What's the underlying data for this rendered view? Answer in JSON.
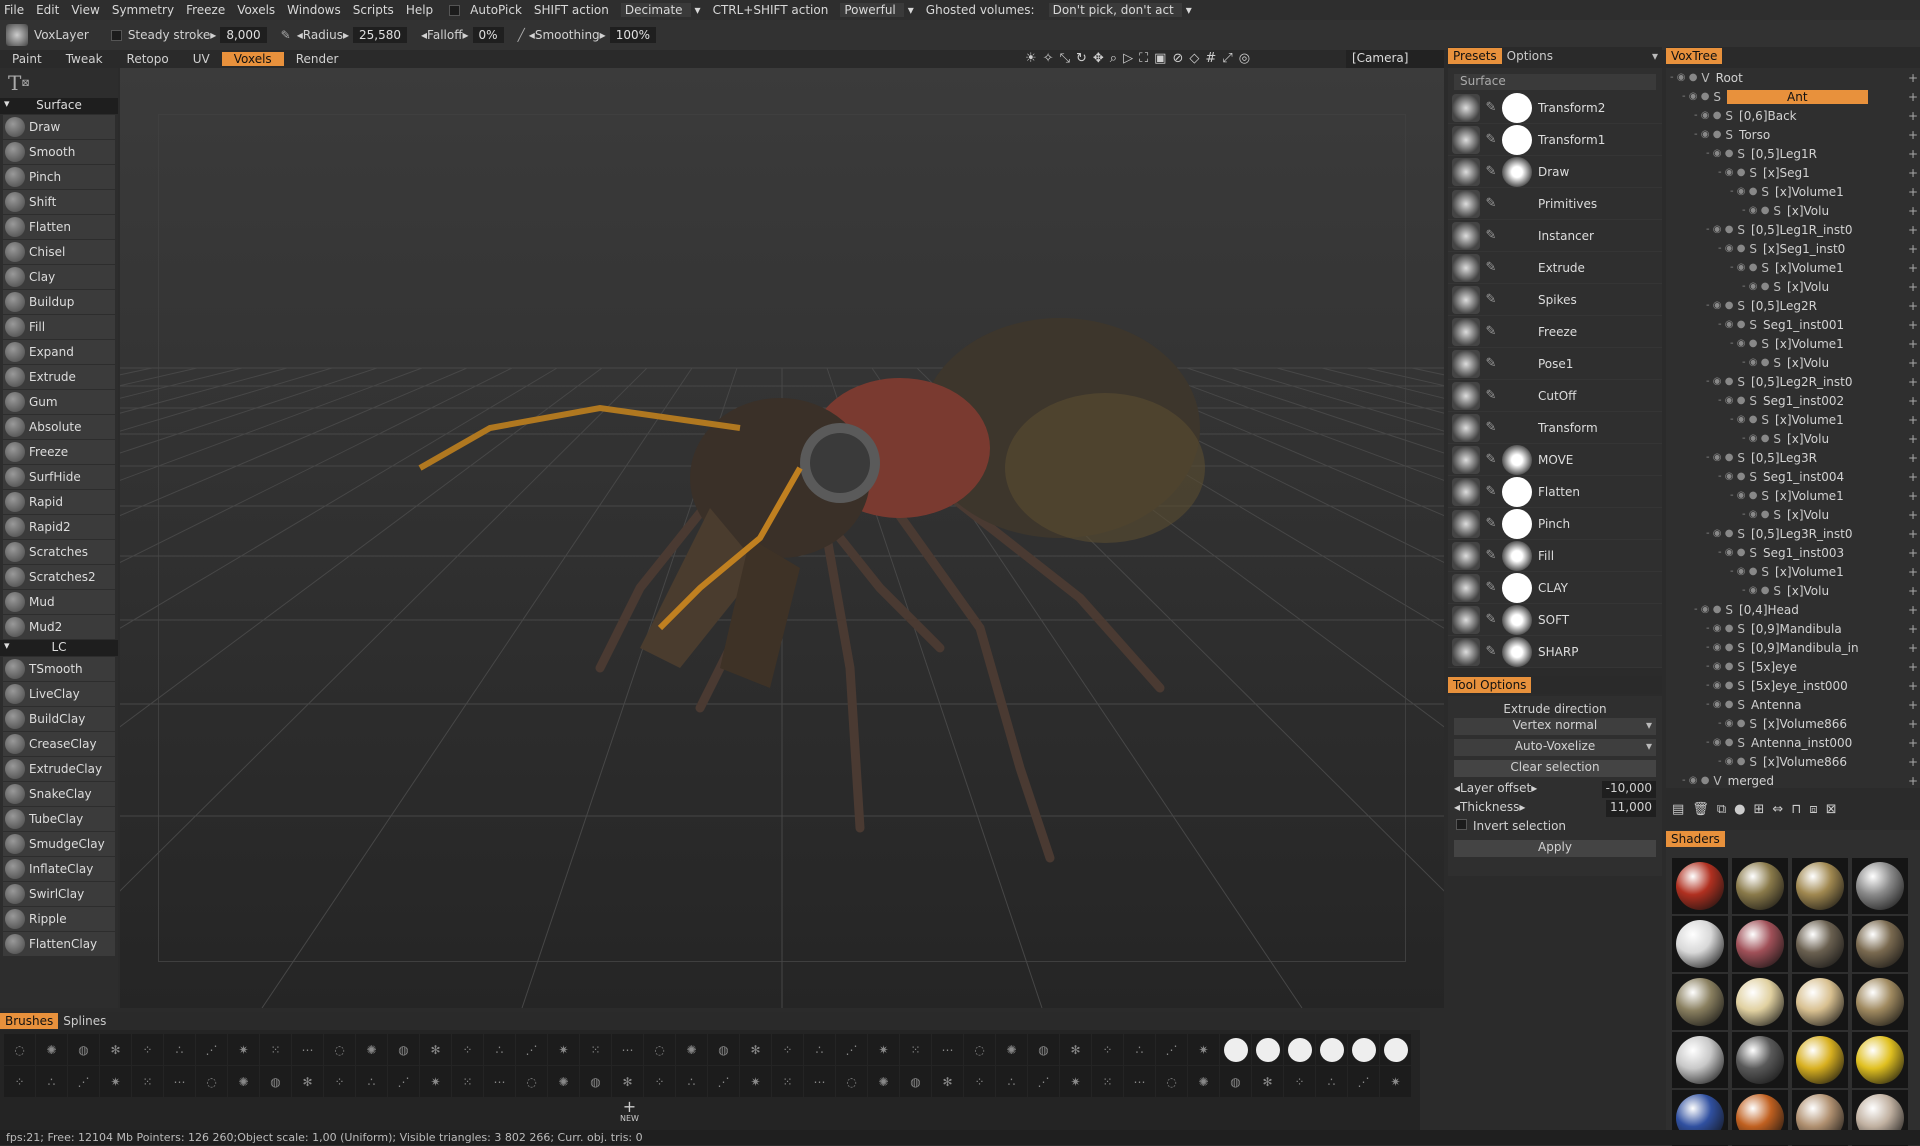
{
  "menu": [
    "File",
    "Edit",
    "View",
    "Symmetry",
    "Freeze",
    "Voxels",
    "Windows",
    "Scripts",
    "Help"
  ],
  "autopick": "AutoPick",
  "shift_action_label": "SHIFT  action",
  "shift_action_value": "Decimate",
  "ctrl_shift_label": "CTRL+SHIFT  action",
  "ctrl_shift_value": "Powerful",
  "ghosted_label": "Ghosted volumes:",
  "ghosted_value": "Don't pick, don't act",
  "toolbar": {
    "layer": "VoxLayer",
    "steady_label": "Steady  stroke▸",
    "steady_value": "8,000",
    "radius_label": "◂Radius▸",
    "radius_value": "25,580",
    "falloff_label": "◂Falloff▸",
    "falloff_value": "0%",
    "smoothing_label": "◂Smoothing▸",
    "smoothing_value": "100%"
  },
  "rooms": [
    "Paint",
    "Tweak",
    "Retopo",
    "UV",
    "Voxels",
    "Render"
  ],
  "active_room": "Voxels",
  "camera": "[Camera]",
  "surface_tools": [
    "Draw",
    "Smooth",
    "Pinch",
    "Shift",
    "Flatten",
    "Chisel",
    "Clay",
    "Buildup",
    "Fill",
    "Expand",
    "Extrude",
    "Gum",
    "Absolute",
    "Freeze",
    "SurfHide",
    "Rapid",
    "Rapid2",
    "Scratches",
    "Scratches2",
    "Mud",
    "Mud2"
  ],
  "surface_label": "Surface",
  "lc_label": "LC",
  "lc_tools": [
    "TSmooth",
    "LiveClay",
    "BuildClay",
    "CreaseClay",
    "ExtrudeClay",
    "SnakeClay",
    "TubeClay",
    "SmudgeClay",
    "InflateClay",
    "SwirlClay",
    "Ripple",
    "FlattenClay"
  ],
  "presets": {
    "tab_presets": "Presets",
    "tab_options": "Options",
    "group": "Surface",
    "items": [
      {
        "label": "Transform2",
        "ball": true
      },
      {
        "label": "Transform1",
        "ball": true
      },
      {
        "label": "Draw",
        "ball": "soft"
      },
      {
        "label": "Primitives",
        "ball": false
      },
      {
        "label": "Instancer",
        "ball": false
      },
      {
        "label": "Extrude",
        "ball": false
      },
      {
        "label": "Spikes",
        "ball": false
      },
      {
        "label": "Freeze",
        "ball": false
      },
      {
        "label": "Pose1",
        "ball": false
      },
      {
        "label": "CutOff",
        "ball": false
      },
      {
        "label": "Transform",
        "ball": false
      },
      {
        "label": "MOVE",
        "ball": "soft"
      },
      {
        "label": "Flatten",
        "ball": true
      },
      {
        "label": "Pinch",
        "ball": true
      },
      {
        "label": "Fill",
        "ball": "soft"
      },
      {
        "label": "CLAY",
        "ball": true
      },
      {
        "label": "SOFT",
        "ball": "soft"
      },
      {
        "label": "SHARP",
        "ball": "soft"
      }
    ]
  },
  "tool_options": {
    "title": "Tool  Options",
    "extrude_direction": "Extrude  direction",
    "vertex_normal": "Vertex  normal",
    "auto_voxelize": "Auto-Voxelize",
    "clear_selection": "Clear  selection",
    "layer_offset_label": "◂Layer  offset▸",
    "layer_offset_value": "-10,000",
    "thickness_label": "◂Thickness▸",
    "thickness_value": "11,000",
    "invert_selection": "Invert  selection",
    "apply": "Apply"
  },
  "voxtree": {
    "title": "VoxTree",
    "rows": [
      {
        "name": "Root",
        "indent": 0,
        "type": "V"
      },
      {
        "name": "Ant",
        "indent": 1,
        "type": "S",
        "selected": true
      },
      {
        "name": "[0,6]Back",
        "indent": 2,
        "type": "S"
      },
      {
        "name": "Torso",
        "indent": 2,
        "type": "S"
      },
      {
        "name": "[0,5]Leg1R",
        "indent": 3,
        "type": "S"
      },
      {
        "name": "[x]Seg1",
        "indent": 4,
        "type": "S"
      },
      {
        "name": "[x]Volume1",
        "indent": 5,
        "type": "S"
      },
      {
        "name": "[x]Volu",
        "indent": 6,
        "type": "S"
      },
      {
        "name": "[0,5]Leg1R_inst0",
        "indent": 3,
        "type": "S"
      },
      {
        "name": "[x]Seg1_inst0",
        "indent": 4,
        "type": "S"
      },
      {
        "name": "[x]Volume1",
        "indent": 5,
        "type": "S"
      },
      {
        "name": "[x]Volu",
        "indent": 6,
        "type": "S"
      },
      {
        "name": "[0,5]Leg2R",
        "indent": 3,
        "type": "S"
      },
      {
        "name": "Seg1_inst001",
        "indent": 4,
        "type": "S"
      },
      {
        "name": "[x]Volume1",
        "indent": 5,
        "type": "S"
      },
      {
        "name": "[x]Volu",
        "indent": 6,
        "type": "S"
      },
      {
        "name": "[0,5]Leg2R_inst0",
        "indent": 3,
        "type": "S"
      },
      {
        "name": "Seg1_inst002",
        "indent": 4,
        "type": "S"
      },
      {
        "name": "[x]Volume1",
        "indent": 5,
        "type": "S"
      },
      {
        "name": "[x]Volu",
        "indent": 6,
        "type": "S"
      },
      {
        "name": "[0,5]Leg3R",
        "indent": 3,
        "type": "S"
      },
      {
        "name": "Seg1_inst004",
        "indent": 4,
        "type": "S"
      },
      {
        "name": "[x]Volume1",
        "indent": 5,
        "type": "S"
      },
      {
        "name": "[x]Volu",
        "indent": 6,
        "type": "S"
      },
      {
        "name": "[0,5]Leg3R_inst0",
        "indent": 3,
        "type": "S"
      },
      {
        "name": "Seg1_inst003",
        "indent": 4,
        "type": "S"
      },
      {
        "name": "[x]Volume1",
        "indent": 5,
        "type": "S"
      },
      {
        "name": "[x]Volu",
        "indent": 6,
        "type": "S"
      },
      {
        "name": "[0,4]Head",
        "indent": 2,
        "type": "S"
      },
      {
        "name": "[0,9]Mandibula",
        "indent": 3,
        "type": "S"
      },
      {
        "name": "[0,9]Mandibula_in",
        "indent": 3,
        "type": "S"
      },
      {
        "name": "[5x]eye",
        "indent": 3,
        "type": "S"
      },
      {
        "name": "[5x]eye_inst000",
        "indent": 3,
        "type": "S"
      },
      {
        "name": "Antenna",
        "indent": 3,
        "type": "S"
      },
      {
        "name": "[x]Volume866",
        "indent": 4,
        "type": "S"
      },
      {
        "name": "Antenna_inst000",
        "indent": 3,
        "type": "S"
      },
      {
        "name": "[x]Volume866",
        "indent": 4,
        "type": "S"
      },
      {
        "name": "merged",
        "indent": 1,
        "type": "V"
      }
    ]
  },
  "shaders": {
    "title": "Shaders",
    "swatches": [
      "#b03020",
      "#8a7a4a",
      "#a08850",
      "#8a8a8a",
      "#d8d8d8",
      "#a05058",
      "#6a6050",
      "#7a6a50",
      "#8a8060",
      "#e0d0a0",
      "#d8c090",
      "#a08a60",
      "#c8c8c8",
      "#5a5a5a",
      "#d8b020",
      "#e0c020",
      "#3050a0",
      "#c06020",
      "#b09070",
      "#c0b0a0"
    ]
  },
  "bottom": {
    "tab_brushes": "Brushes",
    "tab_splines": "Splines",
    "new_label": "NEW"
  },
  "status": "fps:21;     Free: 12104  Mb Pointers: 126 260;Object  scale: 1,00  (Uniform); Visible  triangles: 3 802 266;  Curr. obj. tris: 0"
}
